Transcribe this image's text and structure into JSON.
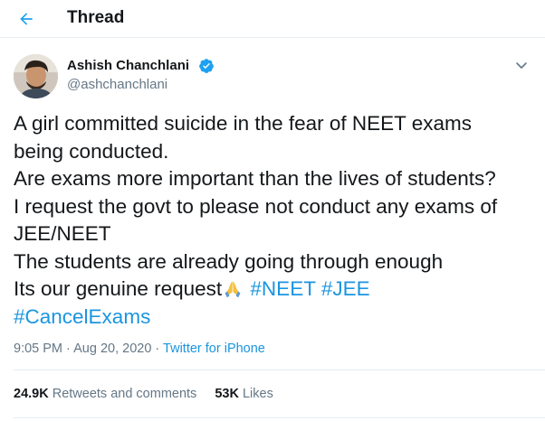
{
  "header": {
    "title": "Thread",
    "back_icon": "arrow-left-icon",
    "accent": "#1da1f2"
  },
  "tweet": {
    "author": {
      "name": "Ashish Chanchlani",
      "handle": "@ashchanchlani",
      "verified": true
    },
    "lines": [
      "A girl committed suicide in the fear of NEET exams",
      "being conducted.",
      "Are exams more important than the lives of students?",
      "I request the govt to please not conduct any exams of",
      "JEE/NEET",
      "The students are already going through enough"
    ],
    "last_line_text": "Its our genuine request",
    "emoji": "folded-hands-icon",
    "hashtags": [
      "#NEET",
      "#JEE",
      "#CancelExams"
    ],
    "time": "9:05 PM",
    "date": "Aug 20, 2020",
    "separator": "·",
    "source": "Twitter for iPhone",
    "retweets_count": "24.9K",
    "retweets_label": "Retweets and comments",
    "likes_count": "53K",
    "likes_label": "Likes"
  },
  "colors": {
    "link": "#1b95e0",
    "secondary_text": "#657786",
    "border": "#e6ecf0"
  }
}
